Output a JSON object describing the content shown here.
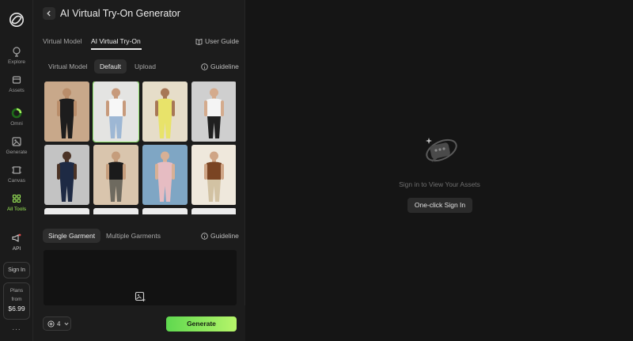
{
  "rail": {
    "items": [
      {
        "label": "Explore",
        "icon": "compass-icon"
      },
      {
        "label": "Assets",
        "icon": "folder-icon"
      },
      {
        "label": "Omni",
        "icon": "omni-ring-icon"
      },
      {
        "label": "Generate",
        "icon": "generate-icon"
      },
      {
        "label": "Canvas",
        "icon": "canvas-icon"
      },
      {
        "label": "All Tools",
        "icon": "grid-icon"
      }
    ],
    "api_label": "API",
    "signin_label": "Sign In",
    "plans": {
      "label": "Plans",
      "from": "from",
      "price": "$6.99"
    },
    "more_label": "..."
  },
  "panel": {
    "title": "AI Virtual Try-On Generator",
    "tabs": [
      {
        "label": "Virtual Model",
        "active": false
      },
      {
        "label": "AI Virtual Try-On",
        "active": true
      }
    ],
    "user_guide": "User Guide",
    "model_source": [
      {
        "label": "Virtual Model",
        "active": false
      },
      {
        "label": "Default",
        "active": true
      },
      {
        "label": "Upload",
        "active": false
      }
    ],
    "guideline": "Guideline",
    "models": [
      {
        "bg": "#c8a88a",
        "top": "#1d1d1d",
        "bottom": "#1d1d1d",
        "skin": "#b98d6a",
        "selected": false
      },
      {
        "bg": "#e4e4e2",
        "top": "#f7f7f7",
        "bottom": "#9db7d4",
        "skin": "#c79a7b",
        "selected": true
      },
      {
        "bg": "#e6ddc9",
        "top": "#e8e36a",
        "bottom": "#e8e36a",
        "skin": "#a77756",
        "selected": false
      },
      {
        "bg": "#cfcfcf",
        "top": "#f4f4f4",
        "bottom": "#202020",
        "skin": "#d4ab8d",
        "selected": false
      },
      {
        "bg": "#c3c3c3",
        "top": "#1e2a44",
        "bottom": "#1e2a44",
        "skin": "#4b3326",
        "selected": false
      },
      {
        "bg": "#d9c5ad",
        "top": "#1b1b1b",
        "bottom": "#6e6a5f",
        "skin": "#c59d7c",
        "selected": false
      },
      {
        "bg": "#7fa6c4",
        "top": "#e6bcc2",
        "bottom": "#e6bcc2",
        "skin": "#d8b095",
        "selected": false
      },
      {
        "bg": "#efe8dc",
        "top": "#7a4423",
        "bottom": "#d2c2a3",
        "skin": "#cfa586",
        "selected": false
      },
      {
        "bg": "#ececec",
        "top": "#ececec",
        "bottom": "#ececec",
        "skin": "#8a6a55",
        "selected": false
      },
      {
        "bg": "#ececec",
        "top": "#ececec",
        "bottom": "#ececec",
        "skin": "#8a6a55",
        "selected": false
      },
      {
        "bg": "#ececec",
        "top": "#ececec",
        "bottom": "#ececec",
        "skin": "#8a6a55",
        "selected": false
      },
      {
        "bg": "#ececec",
        "top": "#ececec",
        "bottom": "#ececec",
        "skin": "#8a6a55",
        "selected": false
      }
    ],
    "garment_modes": [
      {
        "label": "Single Garment",
        "active": true
      },
      {
        "label": "Multiple Garments",
        "active": false
      }
    ],
    "garment_guideline": "Guideline",
    "credits": "4",
    "generate_label": "Generate"
  },
  "right": {
    "empty_text": "Sign in to View Your Assets",
    "signin_button": "One-click Sign In"
  },
  "colors": {
    "accent": "#9ff05a",
    "generate_start": "#5fd84f",
    "generate_end": "#b6f56a"
  }
}
